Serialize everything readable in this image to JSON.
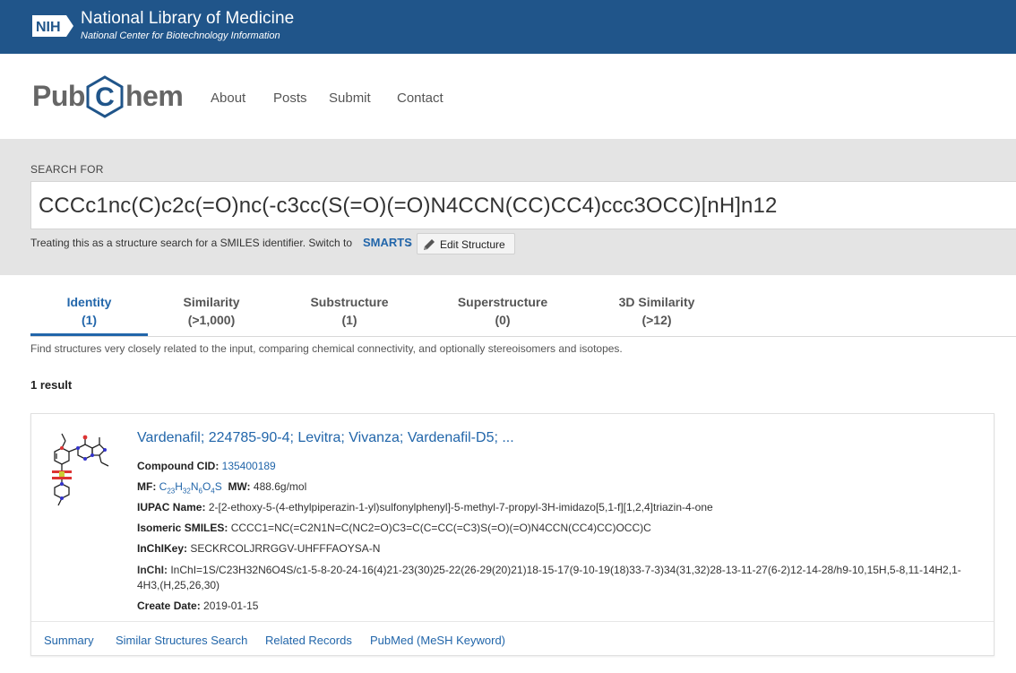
{
  "nih": {
    "logo_text": "NIH",
    "title": "National Library of Medicine",
    "subtitle": "National Center for Biotechnology Information"
  },
  "pubchem": {
    "logo_pub": "Pub",
    "logo_c": "C",
    "logo_hem": "hem",
    "nav": [
      "About",
      "Posts",
      "Submit",
      "Contact"
    ]
  },
  "search": {
    "label": "SEARCH FOR",
    "query": "CCCc1nc(C)c2c(=O)nc(-c3cc(S(=O)(=O)N4CCN(CC)CC4)ccc3OCC)[nH]n12",
    "note": "Treating this as a structure search for a SMILES identifier. Switch to",
    "smarts_link": "SMARTS",
    "note_end": ".",
    "edit_button": "Edit Structure"
  },
  "tabs": [
    {
      "label": "Identity",
      "count": "(1)",
      "active": true
    },
    {
      "label": "Similarity",
      "count": "(>1,000)",
      "active": false
    },
    {
      "label": "Substructure",
      "count": "(1)",
      "active": false
    },
    {
      "label": "Superstructure",
      "count": "(0)",
      "active": false
    },
    {
      "label": "3D Similarity",
      "count": "(>12)",
      "active": false
    }
  ],
  "description": "Find structures very closely related to the input, comparing chemical connectivity, and optionally stereoisomers and isotopes.",
  "result_count": "1 result",
  "result": {
    "title": "Vardenafil; 224785-90-4; Levitra; Vivanza; Vardenafil-D5; ...",
    "cid_label": "Compound CID:",
    "cid": "135400189",
    "mf_label": "MF:",
    "mf_parts": [
      "C",
      "23",
      "H",
      "32",
      "N",
      "6",
      "O",
      "4",
      "S"
    ],
    "mw_label": "MW:",
    "mw": "488.6g/mol",
    "iupac_label": "IUPAC Name:",
    "iupac": "2-[2-ethoxy-5-(4-ethylpiperazin-1-yl)sulfonylphenyl]-5-methyl-7-propyl-3H-imidazo[5,1-f][1,2,4]triazin-4-one",
    "smiles_label": "Isomeric SMILES:",
    "smiles": "CCCC1=NC(=C2N1N=C(NC2=O)C3=C(C=CC(=C3)S(=O)(=O)N4CCN(CC4)CC)OCC)C",
    "inchikey_label": "InChIKey:",
    "inchikey": "SECKRCOLJRRGGV-UHFFFAOYSA-N",
    "inchi_label": "InChI:",
    "inchi": "InChI=1S/C23H32N6O4S/c1-5-8-20-24-16(4)21-23(30)25-22(26-29(20)21)18-15-17(9-10-19(18)33-7-3)34(31,32)28-13-11-27(6-2)12-14-28/h9-10,15H,5-8,11-14H2,1-4H3,(H,25,26,30)",
    "date_label": "Create Date:",
    "date": "2019-01-15",
    "footer_links": [
      "Summary",
      "Similar Structures Search",
      "Related Records",
      "PubMed (MeSH Keyword)"
    ]
  },
  "colors": {
    "nih_blue": "#20558a",
    "link_blue": "#2266aa",
    "search_bg": "#e4e4e4"
  }
}
